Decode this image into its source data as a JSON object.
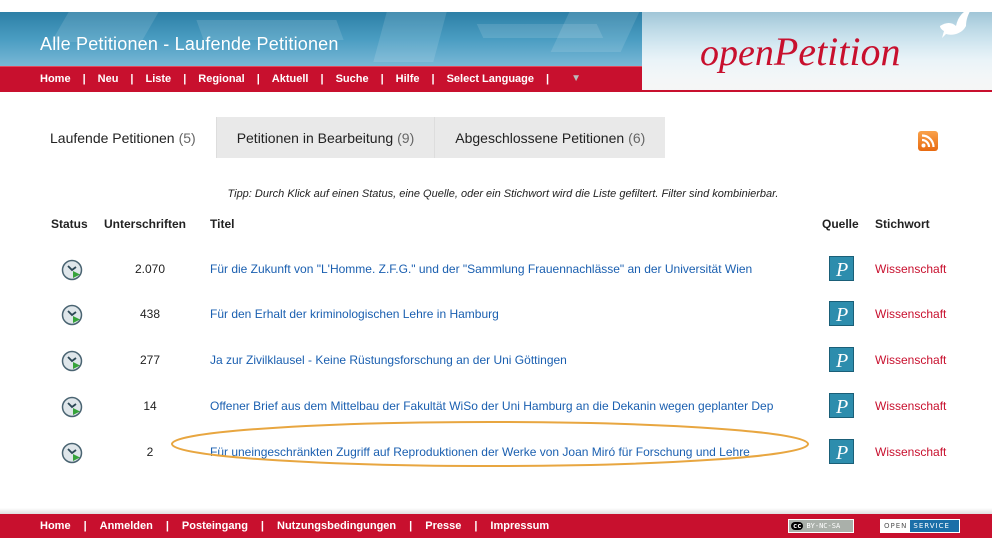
{
  "header": {
    "title": "Alle Petitionen - Laufende Petitionen",
    "logo_part1": "open",
    "logo_part2": "Petition",
    "nav": [
      {
        "label": "Home"
      },
      {
        "label": "Neu"
      },
      {
        "label": "Liste"
      },
      {
        "label": "Regional"
      },
      {
        "label": "Aktuell"
      },
      {
        "label": "Suche"
      },
      {
        "label": "Hilfe"
      },
      {
        "label": "Select Language"
      }
    ]
  },
  "tabs": [
    {
      "label": "Laufende Petitionen",
      "count": "(5)"
    },
    {
      "label": "Petitionen in Bearbeitung",
      "count": "(9)"
    },
    {
      "label": "Abgeschlossene Petitionen",
      "count": "(6)"
    }
  ],
  "tip": "Tipp: Durch Klick auf einen Status, eine Quelle, oder ein Stichwort wird die Liste gefiltert. Filter sind kombinierbar.",
  "table": {
    "headers": {
      "status": "Status",
      "signatures": "Unterschriften",
      "title": "Titel",
      "source": "Quelle",
      "keyword": "Stichwort"
    },
    "rows": [
      {
        "signatures": "2.070",
        "title": "Für die Zukunft von \"L'Homme. Z.F.G.\" und der \"Sammlung Frauennachlässe\" an der Universität Wien",
        "keyword": "Wissenschaft"
      },
      {
        "signatures": "438",
        "title": "Für den Erhalt der kriminologischen Lehre in Hamburg",
        "keyword": "Wissenschaft"
      },
      {
        "signatures": "277",
        "title": "Ja zur Zivilklausel - Keine Rüstungsforschung an der Uni Göttingen",
        "keyword": "Wissenschaft"
      },
      {
        "signatures": "14",
        "title": "Offener Brief aus dem Mittelbau der Fakultät WiSo der Uni Hamburg an die Dekanin wegen geplanter Dep",
        "keyword": "Wissenschaft"
      },
      {
        "signatures": "2",
        "title": "Für uneingeschränkten Zugriff auf Reproduktionen der Werke von Joan Miró für Forschung und Lehre",
        "keyword": "Wissenschaft"
      }
    ]
  },
  "footer": {
    "nav": [
      {
        "label": "Home"
      },
      {
        "label": "Anmelden"
      },
      {
        "label": "Posteingang"
      },
      {
        "label": "Nutzungsbedingungen"
      },
      {
        "label": "Presse"
      },
      {
        "label": "Impressum"
      }
    ],
    "cc_badge": "BY-NC-SA",
    "cc_mark": "cc",
    "open_badge_left": "OPEN",
    "open_badge_right": "SERVICE"
  },
  "colors": {
    "brand_red": "#c8102e",
    "link_blue": "#1a5fb0",
    "highlight": "#e8a640"
  },
  "icons": {
    "status": "running-petition-status-icon",
    "source": "openpetition-source-icon",
    "rss": "rss-feed-icon"
  }
}
